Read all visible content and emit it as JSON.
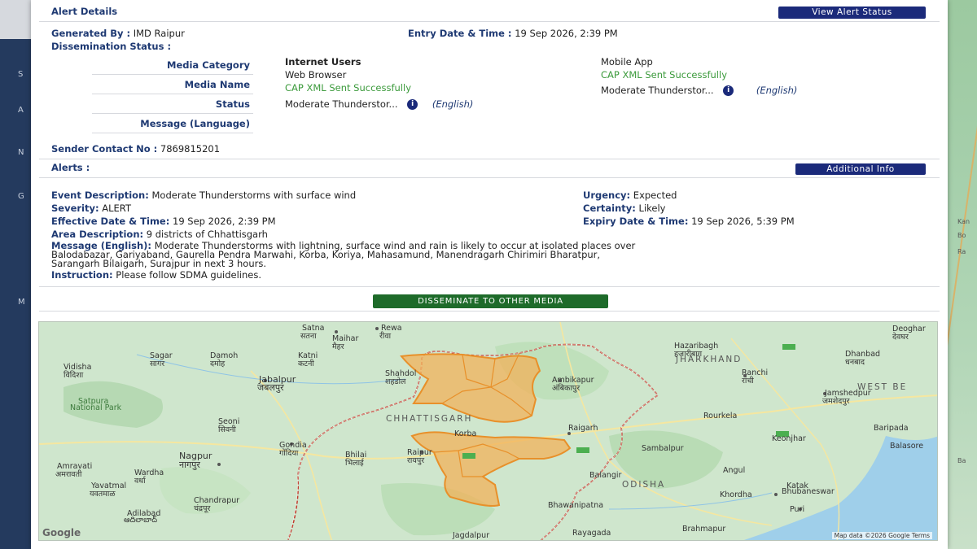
{
  "background": {
    "left_letters": [
      "S",
      "A",
      "N",
      "G",
      "M"
    ],
    "right_labels": [
      "Kan",
      "Bo",
      "Ra",
      "Ba"
    ]
  },
  "alert_details": {
    "title": "Alert Details",
    "view_status_button": "View Alert Status",
    "generated_by_label": "Generated By :",
    "generated_by_value": "IMD Raipur",
    "entry_label": "Entry Date & Time :",
    "entry_value": "19 Sep 2026, 2:39 PM",
    "dissemination_label": "Dissemination Status :",
    "media_rows": [
      "Media Category",
      "Media Name",
      "Status",
      "Message (Language)"
    ],
    "internet": {
      "category": "Internet Users",
      "name": "Web Browser",
      "status": "CAP XML Sent Successfully",
      "message": "Moderate Thunderstor...",
      "language": "(English)"
    },
    "mobile": {
      "category": "Mobile App",
      "status": "CAP XML Sent Successfully",
      "message": "Moderate Thunderstor...",
      "language": "(English)"
    },
    "info_icon": "i",
    "sender_label": "Sender Contact No :",
    "sender_value": "7869815201"
  },
  "alerts": {
    "title": "Alerts :",
    "additional_button": "Additional Info",
    "event_label": "Event Description:",
    "event_value": "Moderate Thunderstorms with surface wind",
    "urgency_label": "Urgency:",
    "urgency_value": "Expected",
    "severity_label": "Severity:",
    "severity_value": "ALERT",
    "certainty_label": "Certainty:",
    "certainty_value": "Likely",
    "effective_label": "Effective Date & Time:",
    "effective_value": "19 Sep 2026, 2:39 PM",
    "expiry_label": "Expiry Date & Time:",
    "expiry_value": "19 Sep 2026, 5:39 PM",
    "area_label": "Area Description:",
    "area_value": "9 districts of Chhattisgarh",
    "message_label": "Message (English):",
    "message_line1": "Moderate Thunderstorms with lightning, surface wind and rain is likely to occur at isolated places over",
    "message_line2": "Balodabazar, Gariyaband, Gaurella Pendra Marwahi, Korba, Koriya, Mahasamund, Manendragarh Chirimiri Bharatpur,",
    "message_line3": "Sarangarh Bilaigarh, Surajpur in next 3 hours.",
    "instruction_label": "Instruction:",
    "instruction_value": "Please follow SDMA guidelines."
  },
  "disseminate_button": "DISSEMINATE TO OTHER MEDIA",
  "map": {
    "google": "Google",
    "credit": "Map data ©2026 Google   Terms",
    "states": [
      "JHARKHAND",
      "CHHATTISGARH",
      "ODISHA",
      "WEST BE"
    ],
    "cities": [
      "Satna",
      "सतना",
      "Rewa",
      "रीवा",
      "Maihar",
      "मैहर",
      "Sagar",
      "सागर",
      "Damoh",
      "दमोह",
      "Katni",
      "कटनी",
      "Vidisha",
      "विदिशा",
      "Jabalpur",
      "जबलपुर",
      "Shahdol",
      "शहडोल",
      "Ambikapur",
      "अंबिकापुर",
      "Satpura",
      "National Park",
      "Seoni",
      "सिवनी",
      "Korba",
      "Raigarh",
      "Nagpur",
      "नागपुर",
      "Gondia",
      "गोंदिया",
      "Bhilai",
      "भिलाई",
      "Raipur",
      "रायपुर",
      "Amravati",
      "अमरावती",
      "Wardha",
      "वर्धा",
      "Yavatmal",
      "यवतमाळ",
      "Adilabad",
      "ఆదిలాబాద్",
      "Chandrapur",
      "चंद्रपूर",
      "Hazaribagh",
      "हजारीबाग",
      "Ranchi",
      "रांची",
      "Dhanbad",
      "धनबाद",
      "Deoghar",
      "देवघर",
      "Jamshedpur",
      "जमशेदपुर",
      "Rourkela",
      "Sambalpur",
      "Baripada",
      "Keonjhar",
      "Balasore",
      "Balangir",
      "Angul",
      "Khordha",
      "Katak",
      "Bhubaneswar",
      "Puri",
      "Bhawanipatna",
      "Rayagada",
      "Brahmapur",
      "Jagdalpur"
    ]
  },
  "colors": {
    "navy": "#1b2a7a",
    "label": "#1f3a73",
    "success": "#3b9a3b",
    "green_button": "#1e6b2a",
    "polygon_fill": "#f2b25a",
    "polygon_stroke": "#e8902a",
    "border": "#c0392b"
  }
}
